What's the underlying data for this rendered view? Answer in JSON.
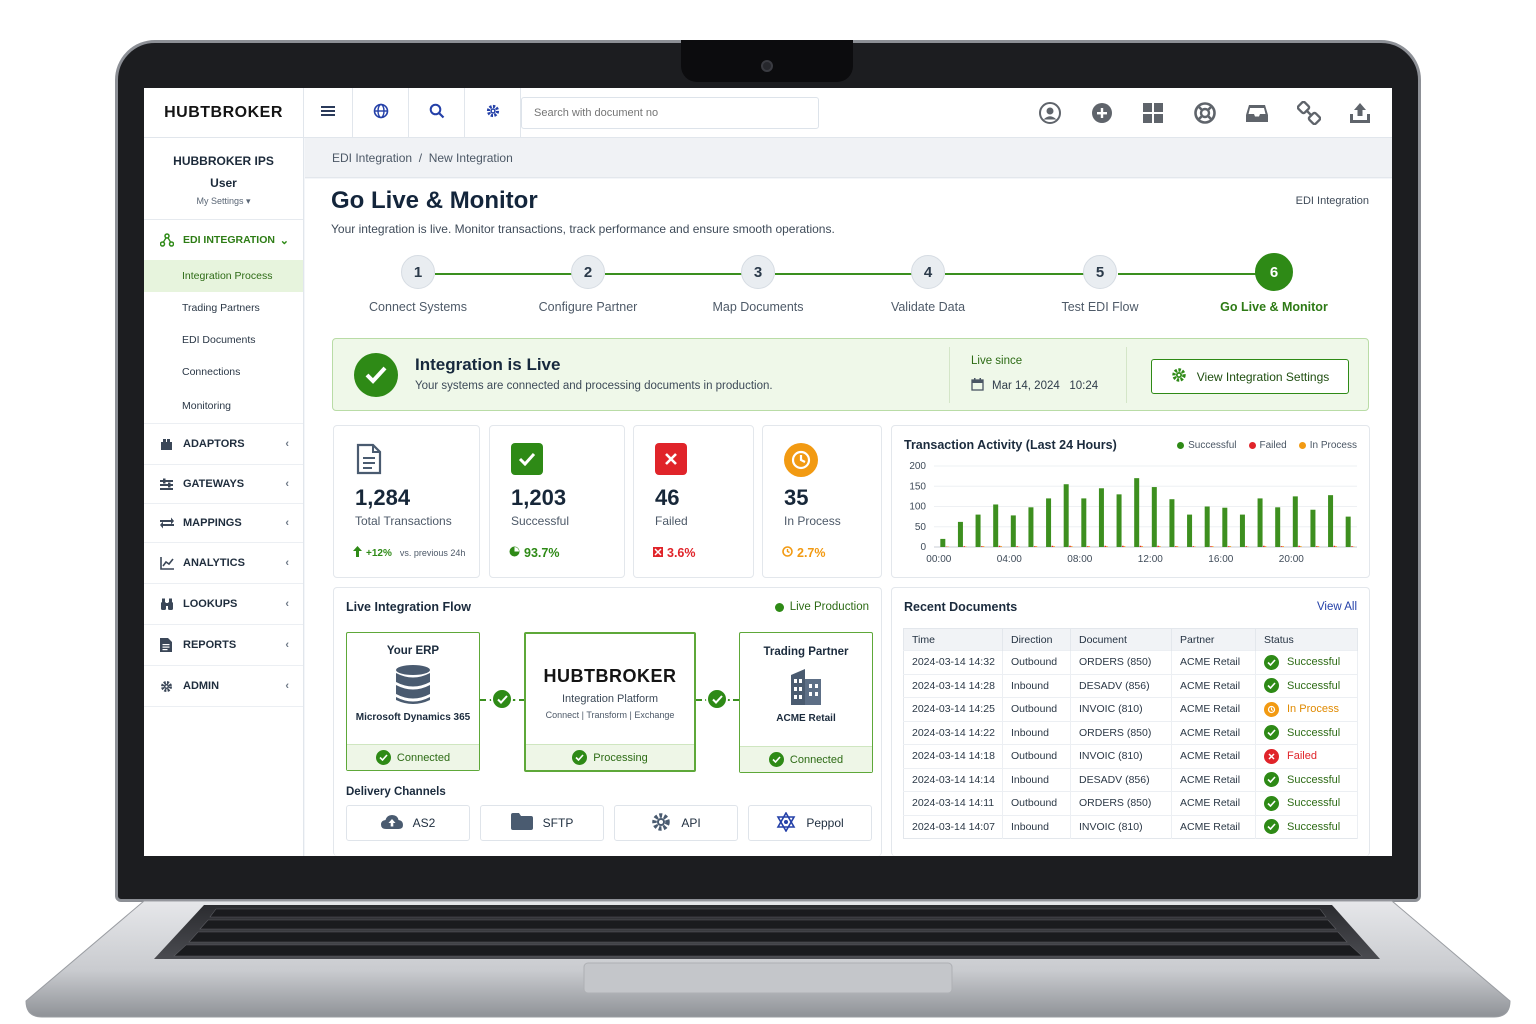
{
  "brand": "HUBTBROKER",
  "search": {
    "placeholder": "Search with document no"
  },
  "user": {
    "company": "HUBBROKER IPS",
    "role": "User",
    "settings": "My Settings ▾"
  },
  "sidebar": {
    "active_section": "EDI INTEGRATION",
    "active_items": [
      "Integration Process",
      "Trading Partners",
      "EDI Documents",
      "Connections",
      "Monitoring"
    ],
    "sections": [
      "ADAPTORS",
      "GATEWAYS",
      "MAPPINGS",
      "ANALYTICS",
      "LOOKUPS",
      "REPORTS",
      "ADMIN"
    ]
  },
  "breadcrumb": "EDI Integration  /  New Integration",
  "page": {
    "title": "Go Live & Monitor",
    "subtitle": "Your integration is live. Monitor transactions, track performance and ensure smooth operations.",
    "context_link": "EDI Integration"
  },
  "steps": [
    {
      "num": "1",
      "label": "Connect Systems"
    },
    {
      "num": "2",
      "label": "Configure Partner"
    },
    {
      "num": "3",
      "label": "Map Documents"
    },
    {
      "num": "4",
      "label": "Validate Data"
    },
    {
      "num": "5",
      "label": "Test EDI Flow"
    },
    {
      "num": "6",
      "label": "Go Live & Monitor"
    }
  ],
  "live_banner": {
    "title": "Integration is Live",
    "text": "Your systems are connected and processing documents in production.",
    "since_label": "Live since",
    "since_value": "Mar 14, 2024   10:24",
    "button": "View Integration Settings"
  },
  "kpis": [
    {
      "value": "1,284",
      "label": "Total Transactions",
      "trend": "+12%",
      "trend_note": "vs. previous 24h",
      "color": "#2e8a16"
    },
    {
      "value": "1,203",
      "label": "Successful",
      "trend": "93.7%",
      "color": "#2e8a16"
    },
    {
      "value": "46",
      "label": "Failed",
      "trend": "3.6%",
      "color": "#e0242a"
    },
    {
      "value": "35",
      "label": "In Process",
      "trend": "2.7%",
      "color": "#f29a12"
    }
  ],
  "activity": {
    "title": "Transaction Activity (Last 24 Hours)",
    "legend": [
      "Successful",
      "Failed",
      "In Process"
    ]
  },
  "chart_data": {
    "type": "bar",
    "title": "Transaction Activity (Last 24 Hours)",
    "x": [
      0,
      1,
      2,
      3,
      4,
      5,
      6,
      7,
      8,
      9,
      10,
      11,
      12,
      13,
      14,
      15,
      16,
      17,
      18,
      19,
      20,
      21,
      22,
      23
    ],
    "xticks": [
      "00:00",
      "04:00",
      "08:00",
      "12:00",
      "16:00",
      "20:00"
    ],
    "ylim": [
      0,
      200
    ],
    "yticks": [
      0,
      50,
      100,
      150,
      200
    ],
    "series": [
      {
        "name": "Successful",
        "values": [
          20,
          62,
          80,
          105,
          78,
          98,
          120,
          155,
          120,
          145,
          130,
          170,
          148,
          118,
          80,
          100,
          97,
          80,
          120,
          98,
          125,
          92,
          128,
          75
        ]
      },
      {
        "name": "Failed",
        "values": [
          1,
          2,
          2,
          3,
          2,
          2,
          3,
          3,
          2,
          3,
          3,
          3,
          3,
          2,
          2,
          2,
          2,
          2,
          3,
          2,
          3,
          2,
          3,
          2
        ]
      },
      {
        "name": "In Process",
        "values": [
          1,
          1,
          2,
          2,
          1,
          2,
          2,
          2,
          2,
          2,
          2,
          2,
          2,
          2,
          1,
          2,
          2,
          1,
          2,
          2,
          2,
          2,
          2,
          1
        ]
      }
    ],
    "colors": {
      "Successful": "#3d8f1f",
      "Failed": "#e0242a",
      "In Process": "#f29a12"
    }
  },
  "flow": {
    "title": "Live Integration Flow",
    "status": "Live Production",
    "erp": {
      "title": "Your ERP",
      "name": "Microsoft Dynamics 365",
      "status": "Connected"
    },
    "hub": {
      "name": "HUBTBROKER",
      "line1": "Integration Platform",
      "line2": "Connect | Transform | Exchange",
      "status": "Processing"
    },
    "partner": {
      "title": "Trading Partner",
      "name": "ACME Retail",
      "status": "Connected"
    },
    "channels_title": "Delivery Channels",
    "channels": [
      "AS2",
      "SFTP",
      "API",
      "Peppol"
    ]
  },
  "recent": {
    "title": "Recent Documents",
    "view_all": "View All",
    "columns": [
      "Time",
      "Direction",
      "Document",
      "Partner",
      "Status"
    ],
    "rows": [
      [
        "2024-03-14 14:32",
        "Outbound",
        "ORDERS (850)",
        "ACME Retail",
        "Successful"
      ],
      [
        "2024-03-14 14:28",
        "Inbound",
        "DESADV (856)",
        "ACME Retail",
        "Successful"
      ],
      [
        "2024-03-14 14:25",
        "Outbound",
        "INVOIC (810)",
        "ACME Retail",
        "In Process"
      ],
      [
        "2024-03-14 14:22",
        "Inbound",
        "ORDERS (850)",
        "ACME Retail",
        "Successful"
      ],
      [
        "2024-03-14 14:18",
        "Outbound",
        "INVOIC (810)",
        "ACME Retail",
        "Failed"
      ],
      [
        "2024-03-14 14:14",
        "Inbound",
        "DESADV (856)",
        "ACME Retail",
        "Successful"
      ],
      [
        "2024-03-14 14:11",
        "Outbound",
        "ORDERS (850)",
        "ACME Retail",
        "Successful"
      ],
      [
        "2024-03-14 14:07",
        "Inbound",
        "INVOIC (810)",
        "ACME Retail",
        "Successful"
      ]
    ]
  }
}
